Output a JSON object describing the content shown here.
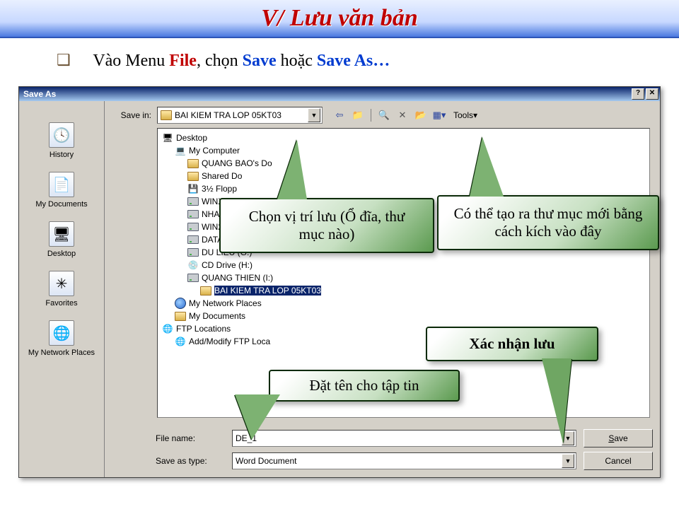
{
  "banner_title": "V/ Lưu văn bản",
  "instruction": {
    "pre": "Vào Menu ",
    "file": "File",
    "mid": ", chọn ",
    "save": "Save",
    "or": " hoặc ",
    "saveas": "Save As…"
  },
  "dialog": {
    "title": "Save As",
    "save_in_label": "Save in:",
    "current_folder": "BAI KIEM TRA LOP 05KT03",
    "toolbar_tools": "Tools",
    "file_name_label": "File name:",
    "file_name_value": "DE_1",
    "save_type_label": "Save as type:",
    "save_type_value": "Word Document",
    "btn_save": "Save",
    "btn_save_u": "S",
    "btn_cancel": "Cancel"
  },
  "sidebar": [
    {
      "label": "History",
      "icon": "🕓"
    },
    {
      "label": "My Documents",
      "icon": "📄"
    },
    {
      "label": "Desktop",
      "icon": "🖥"
    },
    {
      "label": "Favorites",
      "icon": "✳"
    },
    {
      "label": "My Network Places",
      "icon": "🌐"
    }
  ],
  "tree": [
    {
      "indent": 0,
      "icon": "desktop",
      "label": "Desktop"
    },
    {
      "indent": 1,
      "icon": "mycomp",
      "label": "My Computer"
    },
    {
      "indent": 2,
      "icon": "folder",
      "label": "QUANG BAO's Do"
    },
    {
      "indent": 2,
      "icon": "folder",
      "label": "Shared Do"
    },
    {
      "indent": 2,
      "icon": "floppy",
      "label": "3½ Flopp"
    },
    {
      "indent": 2,
      "icon": "drive",
      "label": "WINXP (C"
    },
    {
      "indent": 2,
      "icon": "drive",
      "label": "NHAC (D"
    },
    {
      "indent": 2,
      "icon": "drive",
      "label": "WIN2003 (E:)"
    },
    {
      "indent": 2,
      "icon": "drive",
      "label": "DATA (F:)"
    },
    {
      "indent": 2,
      "icon": "drive",
      "label": "DU LIEU (G:)"
    },
    {
      "indent": 2,
      "icon": "cd",
      "label": "CD Drive (H:)"
    },
    {
      "indent": 2,
      "icon": "drive",
      "label": "QUANG THIEN (I:)"
    },
    {
      "indent": 3,
      "icon": "folder",
      "label": "BAI KIEM TRA LOP 05KT03",
      "selected": true
    },
    {
      "indent": 1,
      "icon": "net",
      "label": "My Network Places"
    },
    {
      "indent": 1,
      "icon": "folder",
      "label": "My Documents"
    },
    {
      "indent": 0,
      "icon": "ftp",
      "label": "FTP Locations"
    },
    {
      "indent": 1,
      "icon": "ftp",
      "label": "Add/Modify FTP Loca"
    }
  ],
  "callouts": {
    "a": "Chọn vị trí lưu (Ổ đĩa, thư mục nào)",
    "b": "Có thể tạo ra thư mục mới bằng cách kích vào đây",
    "c": "Đặt tên cho tập tin",
    "d": "Xác nhận lưu"
  }
}
